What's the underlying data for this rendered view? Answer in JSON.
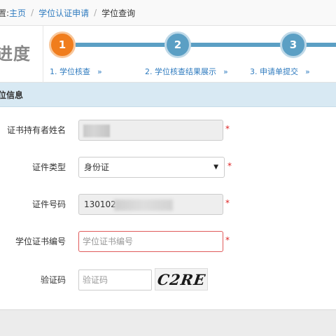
{
  "breadcrumb": {
    "prefix": "置:",
    "home": "主页",
    "apply": "学位认证申请",
    "current": "学位查询"
  },
  "progress": {
    "title": "进度",
    "steps": [
      {
        "number": "1",
        "label": "1. 学位核查",
        "arrow": "»",
        "state": "active"
      },
      {
        "number": "2",
        "label": "2. 学位核查结果展示",
        "arrow": "»",
        "state": "pending"
      },
      {
        "number": "3",
        "label": "3. 申请单提交",
        "arrow": "»",
        "state": "pending"
      }
    ]
  },
  "panel": {
    "title": "位信息"
  },
  "form": {
    "holder_name": {
      "label": "证书持有者姓名",
      "required": "*"
    },
    "id_type": {
      "label": "证件类型",
      "value": "身份证",
      "caret": "▼",
      "required": "*"
    },
    "id_number": {
      "label": "证件号码",
      "value": "130102",
      "required": "*"
    },
    "cert_number": {
      "label": "学位证书编号",
      "placeholder": "学位证书编号",
      "required": "*"
    },
    "captcha": {
      "label": "验证码",
      "placeholder": "验证码",
      "image_text": "C2RE"
    }
  },
  "colors": {
    "active_step": "#f07d1d",
    "pending_step": "#5b9fc4",
    "link": "#2f7bbf",
    "required": "#dd2222",
    "error_border": "#e05a5a"
  }
}
